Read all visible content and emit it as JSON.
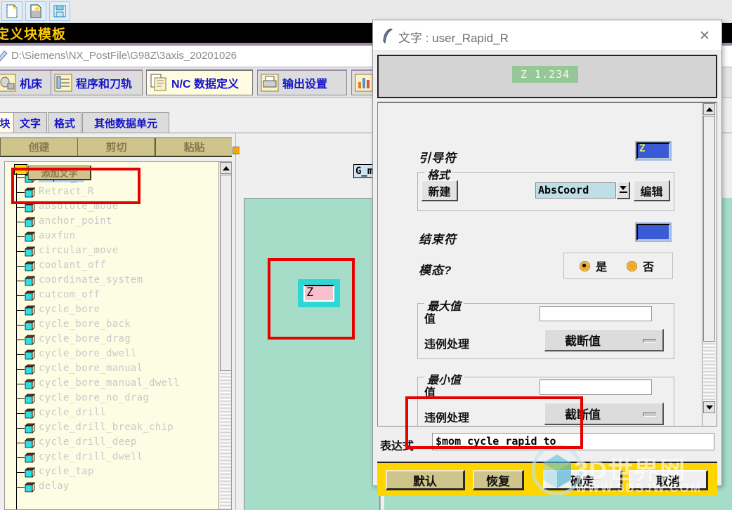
{
  "toolbar": {
    "buttons": [
      {
        "name": "new-file-icon",
        "label": "新建"
      },
      {
        "name": "open-file-icon",
        "label": "打开"
      },
      {
        "name": "save-file-icon",
        "label": "保存"
      }
    ]
  },
  "title_strip": {
    "text": "定义块模板"
  },
  "path_bar": {
    "path": "D:\\Siemens\\NX_PostFile\\G98Z\\3axis_20201026"
  },
  "ribbon": {
    "tabs": [
      {
        "label": "机床",
        "icon": "machine-icon",
        "active": false
      },
      {
        "label": "程序和刀轨",
        "icon": "program-toolpath-icon",
        "active": false
      },
      {
        "label": "N/C 数据定义",
        "icon": "nc-data-definition-icon",
        "active": true
      },
      {
        "label": "输出设置",
        "icon": "output-settings-icon",
        "active": false
      },
      {
        "label": "",
        "icon": "virtual-nc-icon",
        "active": false
      }
    ]
  },
  "subtabs": [
    {
      "label": "块",
      "active": true
    },
    {
      "label": "文字",
      "active": false
    },
    {
      "label": "格式",
      "active": false
    },
    {
      "label": "其他数据单元",
      "active": false
    }
  ],
  "left_panel": {
    "buttons": [
      {
        "label": "创建"
      },
      {
        "label": "剪切"
      },
      {
        "label": "粘贴"
      }
    ],
    "tree_items": [
      {
        "label": "Rapid_R",
        "selected": true
      },
      {
        "label": "Retract_R",
        "selected": false
      },
      {
        "label": "absolute_mode",
        "selected": false
      },
      {
        "label": "anchor_point",
        "selected": false
      },
      {
        "label": "auxfun",
        "selected": false
      },
      {
        "label": "circular_move",
        "selected": false
      },
      {
        "label": "coolant_off",
        "selected": false
      },
      {
        "label": "coordinate_system",
        "selected": false
      },
      {
        "label": "cutcom_off",
        "selected": false
      },
      {
        "label": "cycle_bore",
        "selected": false
      },
      {
        "label": "cycle_bore_back",
        "selected": false
      },
      {
        "label": "cycle_bore_drag",
        "selected": false
      },
      {
        "label": "cycle_bore_dwell",
        "selected": false
      },
      {
        "label": "cycle_bore_manual",
        "selected": false
      },
      {
        "label": "cycle_bore_manual_dwell",
        "selected": false
      },
      {
        "label": "cycle_bore_no_drag",
        "selected": false
      },
      {
        "label": "cycle_drill",
        "selected": false
      },
      {
        "label": "cycle_drill_break_chip",
        "selected": false
      },
      {
        "label": "cycle_drill_deep",
        "selected": false
      },
      {
        "label": "cycle_drill_dwell",
        "selected": false
      },
      {
        "label": "cycle_tap",
        "selected": false
      },
      {
        "label": "delay",
        "selected": false
      }
    ]
  },
  "center_panel": {
    "add_text_button": "添加文字",
    "word_field_value": "G_m",
    "block_word": "Z"
  },
  "dialog": {
    "title": "文字 : user_Rapid_R",
    "icon": "feather-pen-icon",
    "close_icon": "close-icon",
    "preview": "Z   1.234",
    "leader": {
      "label": "引导符",
      "value": "Z",
      "color": "#3b5bd6"
    },
    "format": {
      "group_label": "格式",
      "new_button": "新建",
      "combo_value": "AbsCoord",
      "edit_button": "编辑"
    },
    "trailer": {
      "label": "结束符",
      "value": "",
      "color": "#3b5bd6"
    },
    "modal": {
      "label": "模态?",
      "options": [
        {
          "label": "是",
          "selected": true
        },
        {
          "label": "否",
          "selected": false
        }
      ]
    },
    "max_value": {
      "group_label": "最大值",
      "value_label": "值",
      "value": "",
      "violation_label": "违例处理",
      "violation_value": "截断值"
    },
    "min_value": {
      "group_label": "最小值",
      "value_label": "值",
      "value": "",
      "violation_label": "违例处理",
      "violation_value": "截断值"
    },
    "expression": {
      "label": "表达式",
      "value": "$mom_cycle_rapid_to"
    },
    "buttons": [
      {
        "label": "默认",
        "style": "tan"
      },
      {
        "label": "恢复",
        "style": "tan"
      },
      {
        "label": "确定",
        "style": "plain"
      },
      {
        "label": "取消",
        "style": "plain"
      }
    ]
  },
  "watermark": {
    "main": "3D世界网",
    "sub": "WWW.3DSJW.COM"
  },
  "colors": {
    "accent_yellow": "#ffd500",
    "annotation_red": "#e60000",
    "canvas_green": "#a5ddc8",
    "tree_bg": "#fdfde4",
    "highlight_blue": "#1414c8"
  }
}
